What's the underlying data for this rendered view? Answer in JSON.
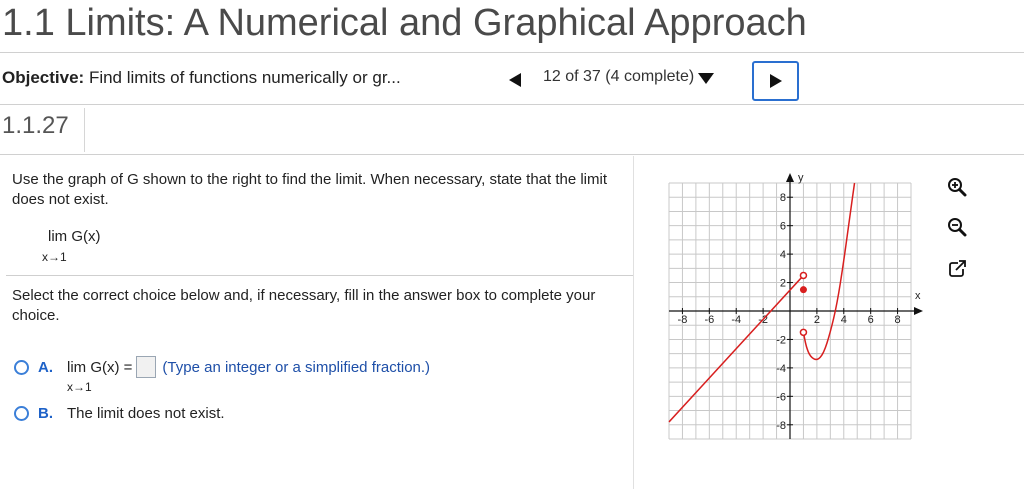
{
  "header": {
    "title": "1.1 Limits: A Numerical and Graphical Approach",
    "objective_label": "Objective:",
    "objective_text": "Find limits of functions numerically or gr...",
    "progress_text": "12 of 37 (4 complete)"
  },
  "question": {
    "number": "1.1.27",
    "instruction": "Use the graph of G shown to the right to find the limit. When necessary, state that the limit does not exist.",
    "limit_expr": "lim G(x)",
    "limit_sub": "x→1",
    "select_text": "Select the correct choice below and, if necessary, fill in the answer box to complete your choice.",
    "choice_a": {
      "letter": "A.",
      "lim_text": "lim G(x) =",
      "lim_sub": "x→1",
      "hint": "(Type an integer or a simplified fraction.)",
      "answer_value": ""
    },
    "choice_b": {
      "letter": "B.",
      "text": "The limit does not exist."
    }
  },
  "graph": {
    "x_label": "x",
    "y_label": "y",
    "x_ticks": [
      "-8",
      "-6",
      "-4",
      "-2",
      "2",
      "4",
      "6",
      "8"
    ],
    "y_ticks": [
      "8",
      "6",
      "4",
      "2",
      "-2",
      "-4",
      "-6",
      "-8"
    ],
    "curve_color": "#d81f1f",
    "grid_color": "#c8c8c8"
  },
  "chart_data": {
    "type": "line",
    "xlim": [
      -9,
      9
    ],
    "ylim": [
      -9,
      9
    ],
    "grid": true,
    "series": [
      {
        "points": [
          [
            -9,
            -7.8
          ],
          [
            1,
            2.5
          ]
        ],
        "end_open": true
      },
      {
        "points": [
          [
            1,
            -1.5
          ],
          [
            1.2,
            -2.5
          ],
          [
            1.5,
            -3.2
          ],
          [
            2,
            -3.5
          ],
          [
            2.5,
            -3
          ],
          [
            3,
            -1.5
          ],
          [
            3.5,
            0.5
          ],
          [
            4,
            3.5
          ],
          [
            4.5,
            7
          ],
          [
            4.8,
            9
          ]
        ],
        "start_open": true
      }
    ],
    "solid_point": [
      1,
      1.5
    ]
  },
  "tools": [
    "zoom-in-icon",
    "zoom-out-icon",
    "open-new-window-icon"
  ]
}
